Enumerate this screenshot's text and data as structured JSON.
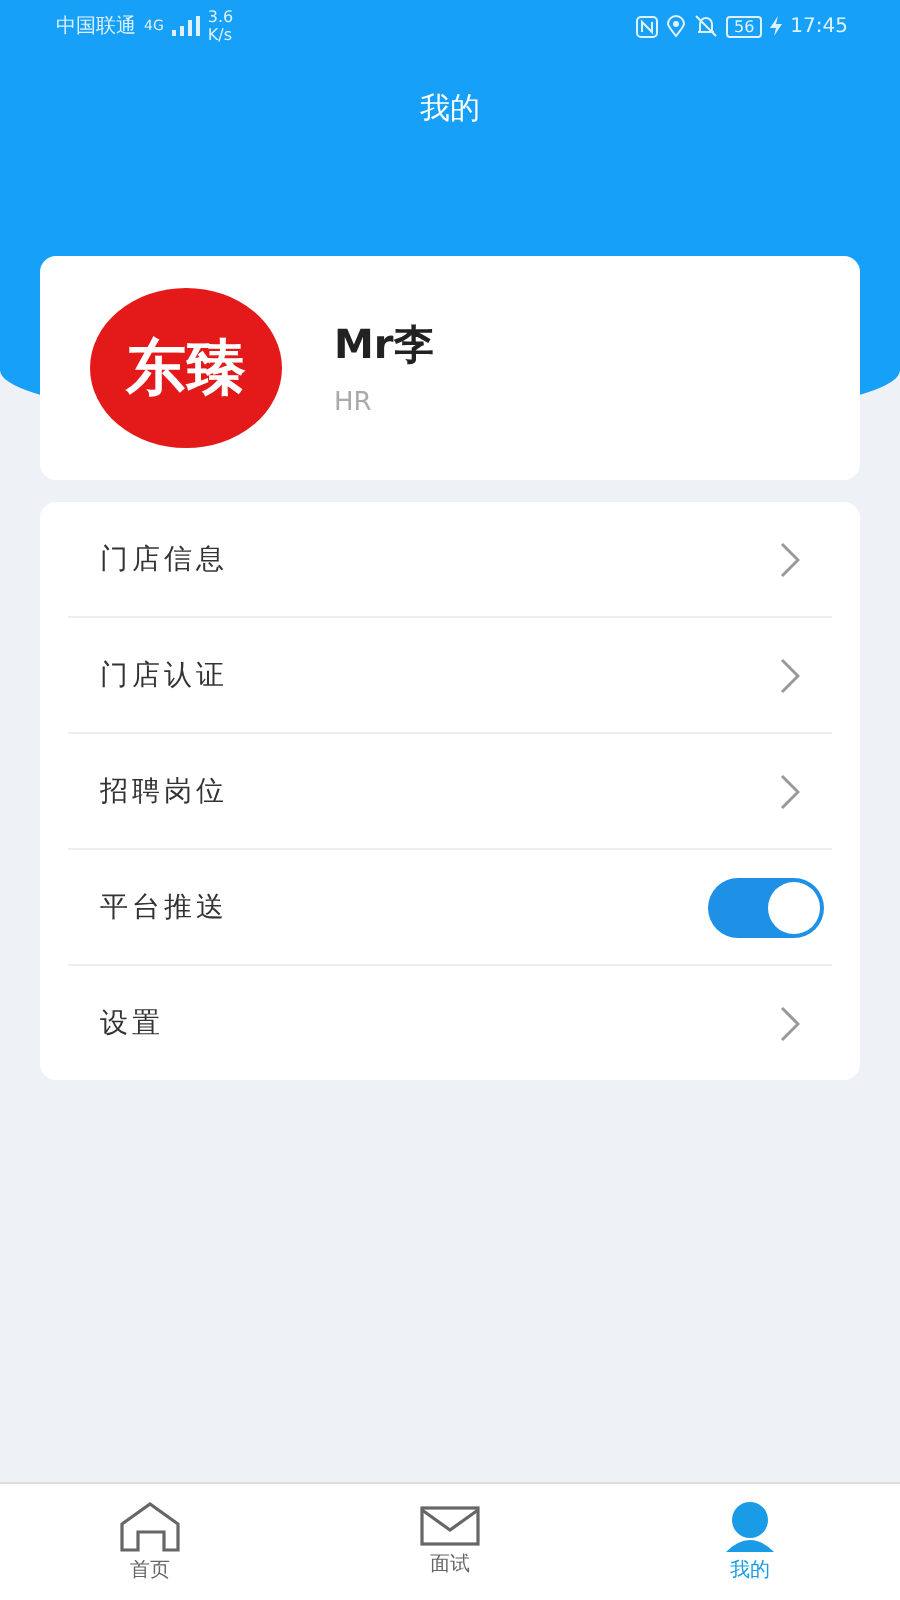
{
  "status_bar": {
    "carrier": "中国联通",
    "network": "4G",
    "speed": "3.6\nK/s",
    "battery": "56",
    "time": "17:45"
  },
  "header": {
    "title": "我的"
  },
  "profile": {
    "logo_text": "东臻",
    "name": "Mr李",
    "role": "HR"
  },
  "menu": [
    {
      "kind": "link",
      "label": "门店信息"
    },
    {
      "kind": "link",
      "label": "门店认证"
    },
    {
      "kind": "link",
      "label": "招聘岗位"
    },
    {
      "kind": "toggle",
      "label": "平台推送",
      "on": true
    },
    {
      "kind": "link",
      "label": "设置"
    }
  ],
  "tabs": [
    {
      "label": "首页",
      "selected": false
    },
    {
      "label": "面试",
      "selected": false
    },
    {
      "label": "我的",
      "selected": true
    }
  ]
}
